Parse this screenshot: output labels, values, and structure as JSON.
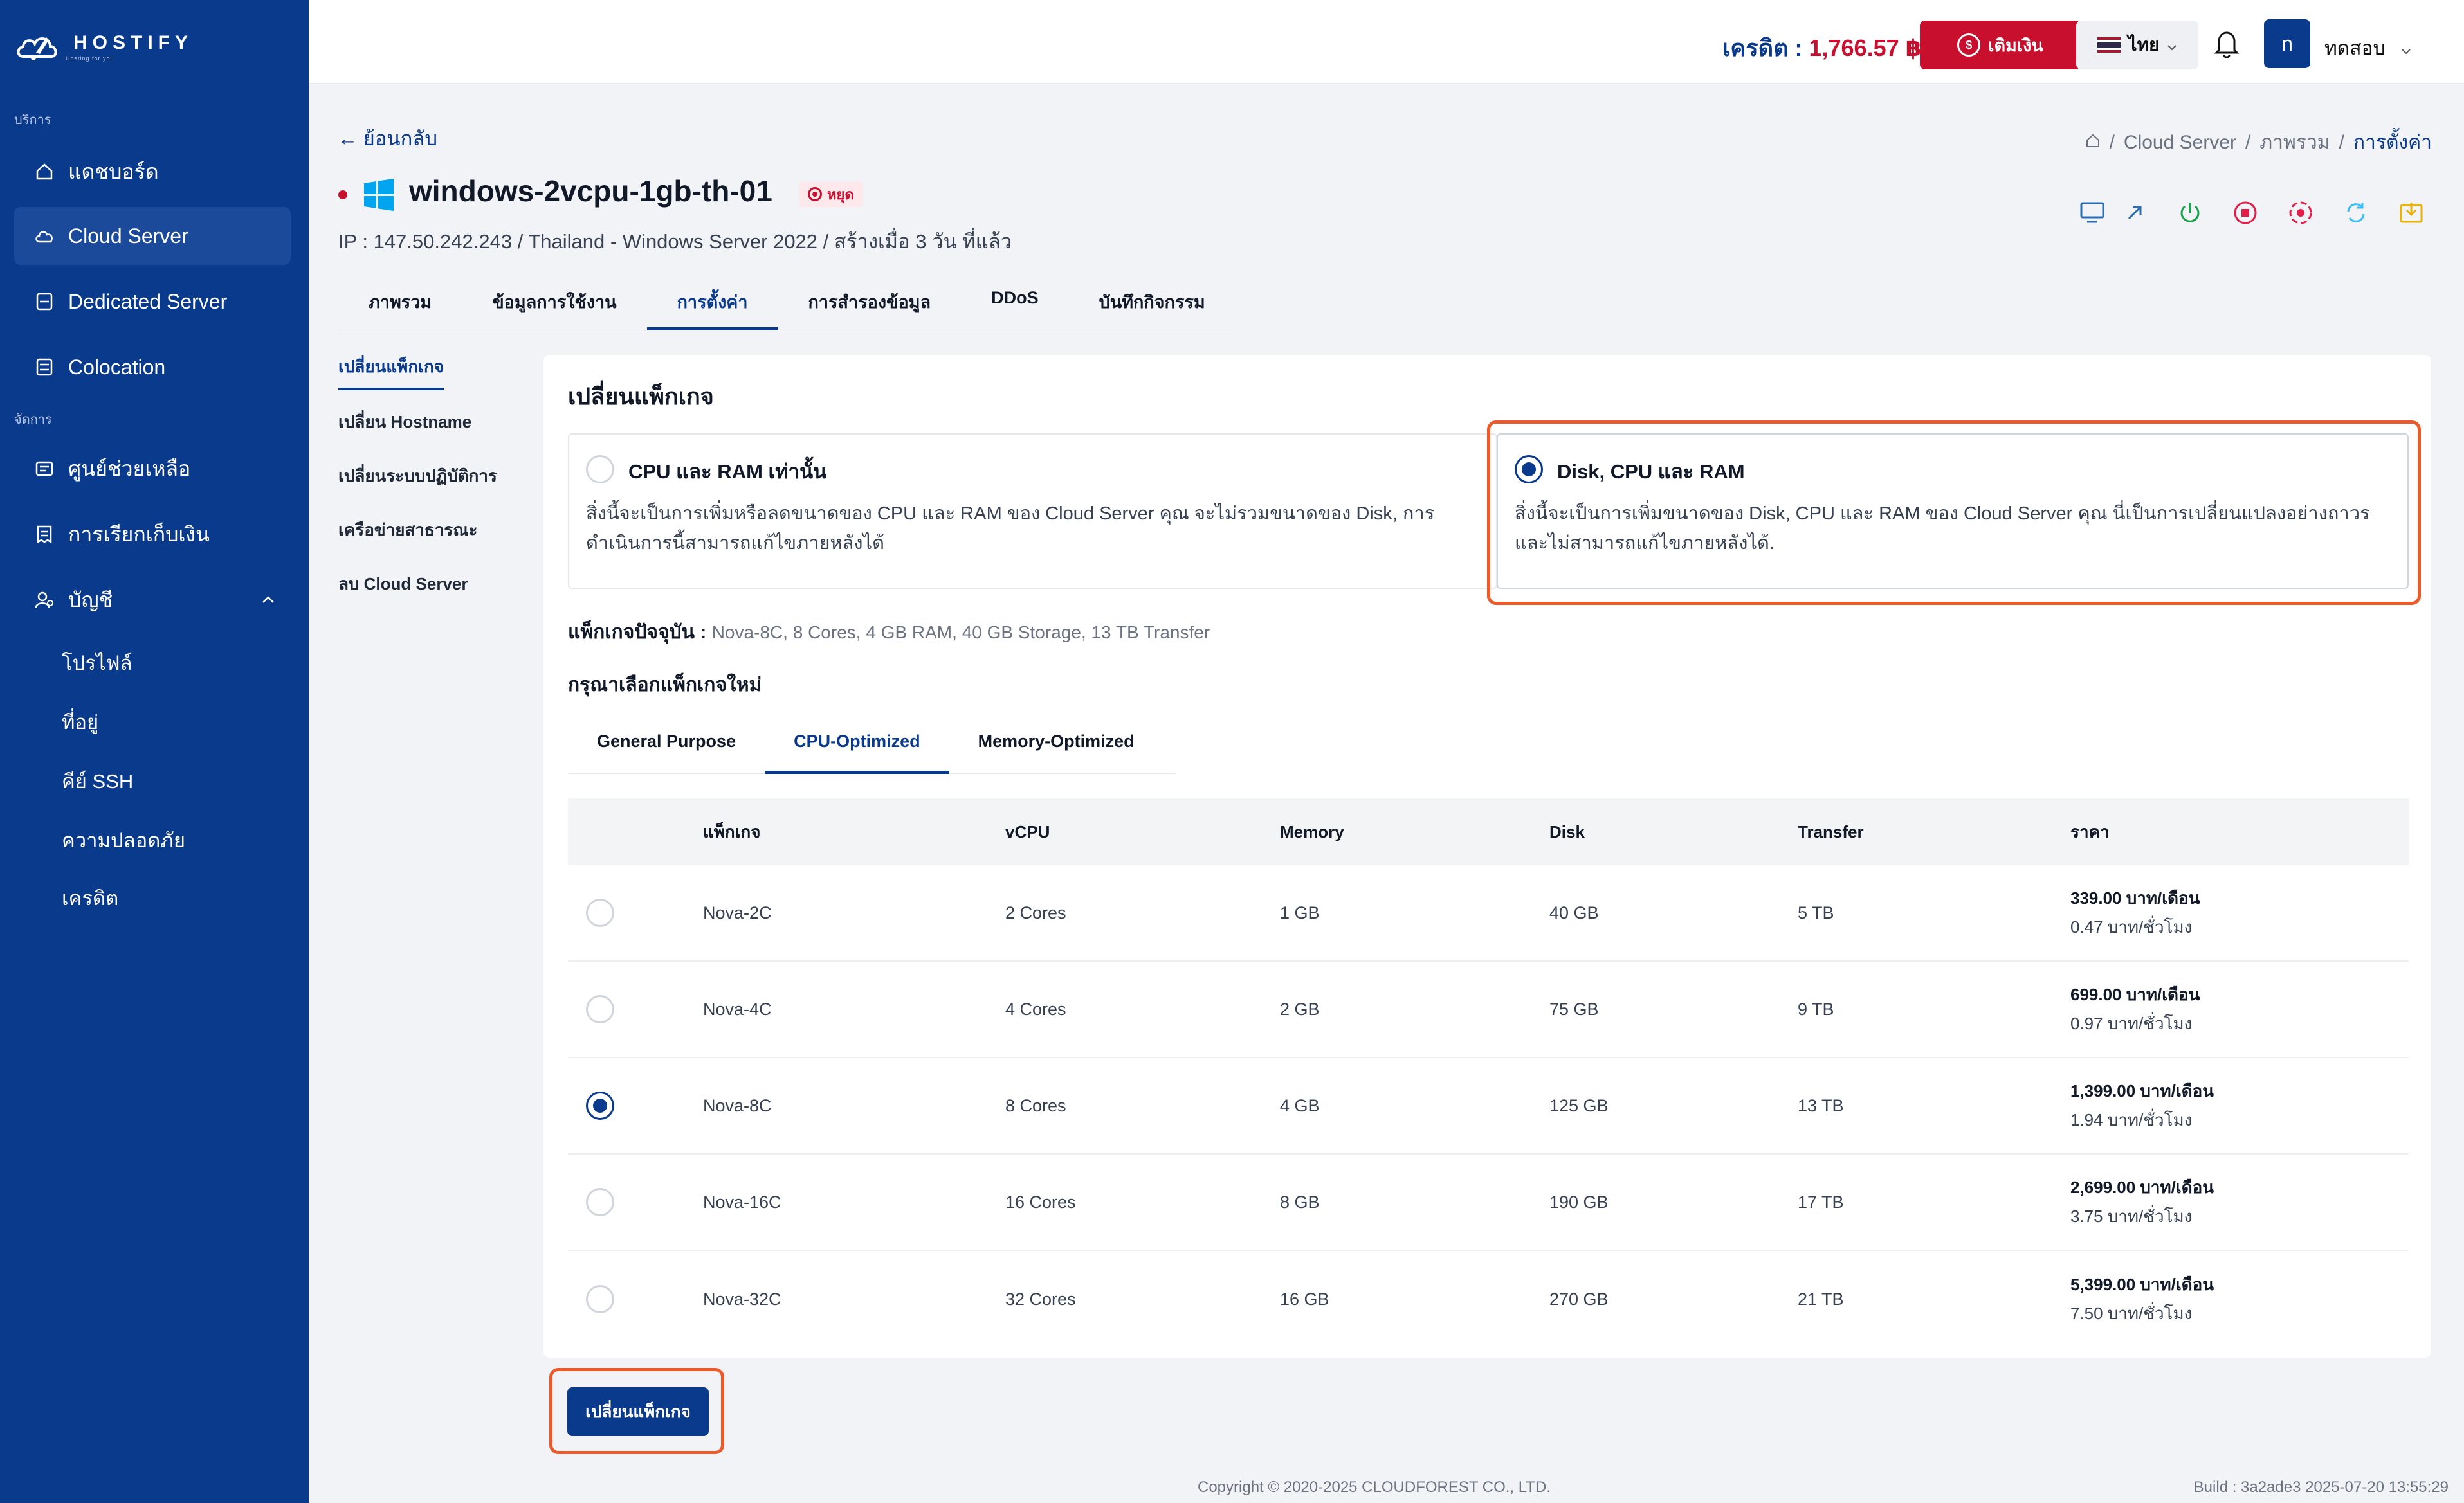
{
  "brand": {
    "name": "HOSTIFY",
    "tagline": "Hosting for you"
  },
  "sidebar": {
    "section_services": "บริการ",
    "section_manage": "จัดการ",
    "items": [
      {
        "label": "แดชบอร์ด",
        "icon": "home-icon"
      },
      {
        "label": "Cloud Server",
        "icon": "cloud-icon",
        "active": true
      },
      {
        "label": "Dedicated Server",
        "icon": "server-icon"
      },
      {
        "label": "Colocation",
        "icon": "rack-icon"
      },
      {
        "label": "ศูนย์ช่วยเหลือ",
        "icon": "support-icon"
      },
      {
        "label": "การเรียกเก็บเงิน",
        "icon": "billing-icon"
      },
      {
        "label": "บัญชี",
        "icon": "account-icon",
        "expanded": true
      }
    ],
    "account_sub": [
      "โปรไฟล์",
      "ที่อยู่",
      "คีย์ SSH",
      "ความปลอดภัย",
      "เครดิต"
    ]
  },
  "topbar": {
    "credit_label": "เครดิต : ",
    "credit_amount": "1,766.57 ฿",
    "topup_label": "เติมเงิน",
    "language": "ไทย",
    "avatar_initial": "n",
    "username": "ทดสอบ"
  },
  "header": {
    "back_label": "ย้อนกลับ",
    "breadcrumb": [
      "Cloud Server",
      "ภาพรวม",
      "การตั้งค่า"
    ],
    "server_name": "windows-2vcpu-1gb-th-01",
    "status": "หยุด",
    "meta": "IP : 147.50.242.243 / Thailand - Windows Server 2022 / สร้างเมื่อ 3 วัน ที่แล้ว"
  },
  "tabs": [
    "ภาพรวม",
    "ข้อมูลการใช้งาน",
    "การตั้งค่า",
    "การสำรองข้อมูล",
    "DDoS",
    "บันทึกกิจกรรม"
  ],
  "settings_menu": [
    "เปลี่ยนแพ็กเกจ",
    "เปลี่ยน Hostname",
    "เปลี่ยนระบบปฏิบัติการ",
    "เครือข่ายสาธารณะ",
    "ลบ Cloud Server"
  ],
  "card": {
    "title": "เปลี่ยนแพ็กเกจ",
    "option1": {
      "title": "CPU และ RAM เท่านั้น",
      "desc": "สิ่งนี้จะเป็นการเพิ่มหรือลดขนาดของ CPU และ RAM ของ Cloud Server คุณ จะไม่รวมขนาดของ Disk, การดำเนินการนี้สามารถแก้ไขภายหลังได้"
    },
    "option2": {
      "title": "Disk, CPU และ RAM",
      "desc": "สิ่งนี้จะเป็นการเพิ่มขนาดของ Disk, CPU และ RAM ของ Cloud Server คุณ นี่เป็นการเปลี่ยนแปลงอย่างถาวร และไม่สามารถแก้ไขภายหลังได้."
    },
    "current_label": "แพ็กเกจปัจจุบัน : ",
    "current_value": "Nova-8C, 8 Cores, 4 GB RAM, 40 GB Storage, 13 TB Transfer",
    "choose_label": "กรุณาเลือกแพ็กเกจใหม่",
    "pkg_tabs": [
      "General Purpose",
      "CPU-Optimized",
      "Memory-Optimized"
    ],
    "columns": [
      "แพ็กเกจ",
      "vCPU",
      "Memory",
      "Disk",
      "Transfer",
      "ราคา"
    ],
    "rows": [
      {
        "name": "Nova-2C",
        "vcpu": "2 Cores",
        "memory": "1 GB",
        "disk": "40 GB",
        "transfer": "5 TB",
        "price_month": "339.00 บาท/เดือน",
        "price_hour": "0.47 บาท/ชั่วโมง",
        "selected": false
      },
      {
        "name": "Nova-4C",
        "vcpu": "4 Cores",
        "memory": "2 GB",
        "disk": "75 GB",
        "transfer": "9 TB",
        "price_month": "699.00 บาท/เดือน",
        "price_hour": "0.97 บาท/ชั่วโมง",
        "selected": false
      },
      {
        "name": "Nova-8C",
        "vcpu": "8 Cores",
        "memory": "4 GB",
        "disk": "125 GB",
        "transfer": "13 TB",
        "price_month": "1,399.00 บาท/เดือน",
        "price_hour": "1.94 บาท/ชั่วโมง",
        "selected": true
      },
      {
        "name": "Nova-16C",
        "vcpu": "16 Cores",
        "memory": "8 GB",
        "disk": "190 GB",
        "transfer": "17 TB",
        "price_month": "2,699.00 บาท/เดือน",
        "price_hour": "3.75 บาท/ชั่วโมง",
        "selected": false
      },
      {
        "name": "Nova-32C",
        "vcpu": "32 Cores",
        "memory": "16 GB",
        "disk": "270 GB",
        "transfer": "21 TB",
        "price_month": "5,399.00 บาท/เดือน",
        "price_hour": "7.50 บาท/ชั่วโมง",
        "selected": false
      }
    ],
    "submit_label": "เปลี่ยนแพ็กเกจ"
  },
  "footer": {
    "copyright": "Copyright © 2020-2025 CLOUDFOREST CO., LTD.",
    "build": "Build : 3a2ade3 2025-07-20 13:55:29"
  },
  "colors": {
    "primary": "#0a3a8c",
    "danger": "#c8102e",
    "highlight": "#ea5a2a"
  }
}
